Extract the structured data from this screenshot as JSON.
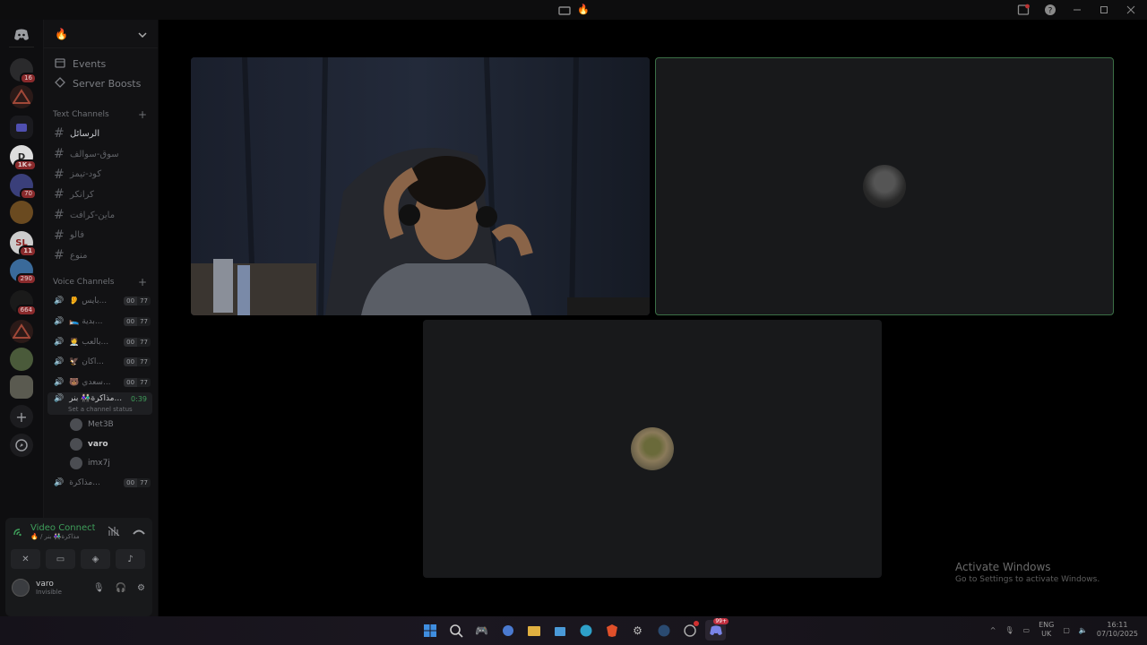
{
  "titlebar": {
    "center_icons": [
      "display-icon",
      "fire-emoji"
    ],
    "right_icons": [
      "inbox-icon",
      "help-icon",
      "minimize-icon",
      "maximize-icon",
      "close-icon"
    ]
  },
  "servers": {
    "badges": [
      "16",
      "1K+",
      "70",
      "11",
      "290",
      "664"
    ]
  },
  "guild": {
    "name": "🔥",
    "nav": [
      {
        "icon": "calendar-icon",
        "label": "Events"
      },
      {
        "icon": "boost-icon",
        "label": "Server Boosts"
      }
    ],
    "text_category": "Text Channels",
    "text_channels": [
      "الرسائل",
      "سوق-سوالف",
      "كود-تيمز",
      "كرانكر",
      "ماين-كرافت",
      "فالو",
      "منوع"
    ],
    "voice_category": "Voice Channels",
    "voice_channels": [
      {
        "name": "👂 بايس...",
        "a": "00",
        "b": "77"
      },
      {
        "name": "🛌 بدية...",
        "a": "00",
        "b": "77"
      },
      {
        "name": "🧑‍⚕️ بالعب...",
        "a": "00",
        "b": "77"
      },
      {
        "name": "🦅 اكان...",
        "a": "00",
        "b": "77"
      },
      {
        "name": "🐻 سعدي...",
        "a": "00",
        "b": "77"
      }
    ],
    "active_voice": {
      "name": "مذاكرة👫🏻 بنر...",
      "time": "0:39",
      "status": "Set a channel status"
    },
    "members": [
      {
        "name": "Met3B",
        "bold": false
      },
      {
        "name": "varo",
        "bold": true
      },
      {
        "name": "imx7j",
        "bold": false
      }
    ],
    "voice_after": [
      {
        "name": "مذاكرة...",
        "a": "00",
        "b": "77"
      }
    ]
  },
  "voice_panel": {
    "title": "Video Connected",
    "subtitle": "🔥 / مذاكرة👫🏻 بنر",
    "buttons": [
      "camera-off-icon",
      "screen-share-icon",
      "activity-icon",
      "soundboard-icon"
    ],
    "user": {
      "name": "varo",
      "status": "Invisible"
    }
  },
  "stage": {
    "tiles": [
      "camera-feed",
      "participant-2",
      "participant-3"
    ]
  },
  "activate": {
    "line1": "Activate Windows",
    "line2": "Go to Settings to activate Windows."
  },
  "taskbar": {
    "lang_top": "ENG",
    "lang_bottom": "UK",
    "time": "16:11",
    "date": "07/10/2025",
    "discord_badge": "99+"
  }
}
